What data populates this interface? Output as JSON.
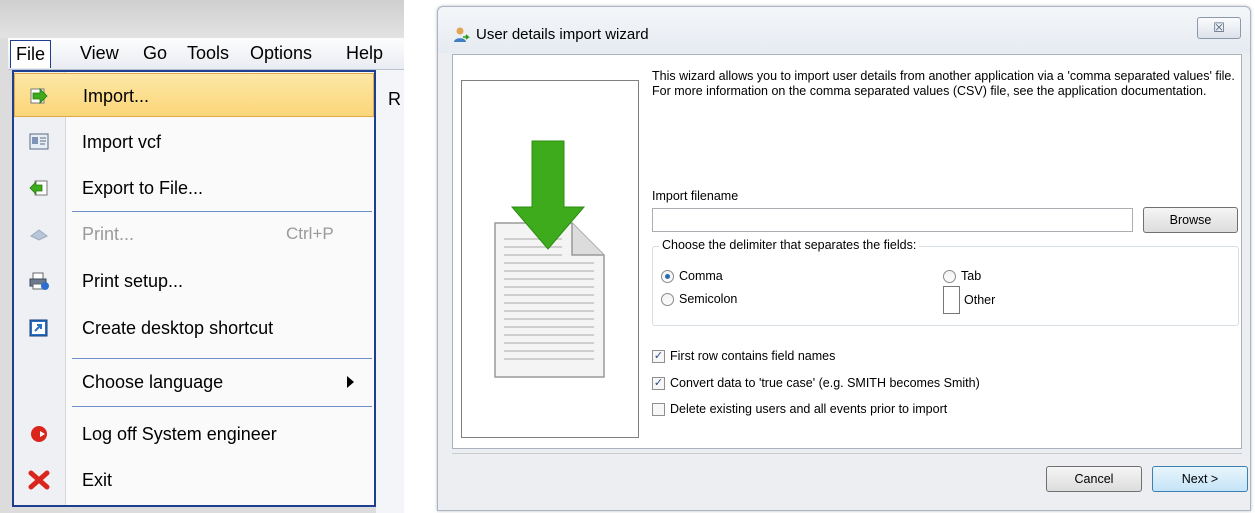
{
  "menu": {
    "menubar": [
      "File",
      "View",
      "Go",
      "Tools",
      "Options",
      "Help"
    ],
    "right_partial": "R",
    "items": [
      {
        "label": "Import...",
        "icon": "import-arrow-icon"
      },
      {
        "label": "Import vcf",
        "icon": "vcard-icon"
      },
      {
        "label": "Export to File...",
        "icon": "export-icon"
      },
      {
        "label": "Print...",
        "shortcut": "Ctrl+P",
        "icon": "print-disabled-icon"
      },
      {
        "label": "Print setup...",
        "icon": "printer-icon"
      },
      {
        "label": "Create desktop shortcut",
        "icon": "shortcut-icon"
      },
      {
        "label": "Choose language",
        "icon": ""
      },
      {
        "label": "Log off System engineer",
        "icon": "logoff-icon"
      },
      {
        "label": "Exit",
        "icon": "exit-x-icon"
      }
    ]
  },
  "dialog": {
    "title": "User details import wizard",
    "close_glyph": "☒",
    "description": "This wizard allows you to import user details from another application via a 'comma separated values' file. For more information on the comma separated values (CSV) file, see the application documentation.",
    "filename_label": "Import filename",
    "filename_value": "",
    "browse_label": "Browse",
    "delimiter_legend": "Choose the delimiter that separates the fields:",
    "delimiters": [
      {
        "label": "Comma",
        "checked": true
      },
      {
        "label": "Tab",
        "checked": false
      },
      {
        "label": "Semicolon",
        "checked": false
      },
      {
        "label": "Other",
        "checked": false
      }
    ],
    "options": [
      {
        "label": "First row contains field names",
        "checked": true
      },
      {
        "label": "Convert data to 'true case' (e.g. SMITH becomes Smith)",
        "checked": true
      },
      {
        "label": "Delete existing users and all events prior to import",
        "checked": false
      }
    ],
    "cancel_label": "Cancel",
    "next_label": "Next >"
  },
  "colors": {
    "menu_border": "#1e3f8f",
    "highlight": "#fbd679",
    "download_arrow": "#3eab1c",
    "next_button_border": "#3c7fb1"
  }
}
